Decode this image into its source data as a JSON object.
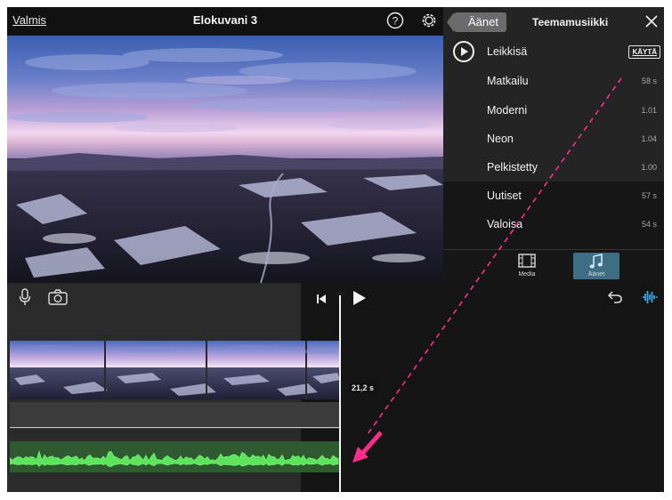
{
  "header": {
    "done_label": "Valmis",
    "project_title": "Elokuvani 3",
    "help_icon": "help-icon",
    "settings_icon": "gear-icon"
  },
  "audio_panel": {
    "back_label": "Äänet",
    "title": "Teemamusiikki",
    "close_icon": "close-icon",
    "play_icon": "play-icon",
    "use_label": "KÄYTÄ",
    "tracks": [
      {
        "name": "Leikkisä",
        "duration": ""
      },
      {
        "name": "Matkailu",
        "duration": "58 s"
      },
      {
        "name": "Moderni",
        "duration": "1.01"
      },
      {
        "name": "Neon",
        "duration": "1.04"
      },
      {
        "name": "Pelkistetty",
        "duration": "1.00"
      },
      {
        "name": "Uutiset",
        "duration": "57 s"
      },
      {
        "name": "Valoisa",
        "duration": "54 s"
      }
    ],
    "tabs": [
      {
        "label": "Media",
        "icon": "film-icon",
        "active": false
      },
      {
        "label": "Äänet",
        "icon": "music-note-icon",
        "active": true
      }
    ]
  },
  "timeline": {
    "playhead_time": "21,2 s",
    "icons": [
      "microphone-icon",
      "camera-icon",
      "skip-to-start-icon",
      "play-icon",
      "undo-icon",
      "audio-waveform-icon"
    ]
  },
  "colors": {
    "accent_blue": "#3aa7e0",
    "audio_green": "#4fd64f",
    "annotation_pink": "#ff2d8a",
    "active_tab": "#3d6e84"
  }
}
